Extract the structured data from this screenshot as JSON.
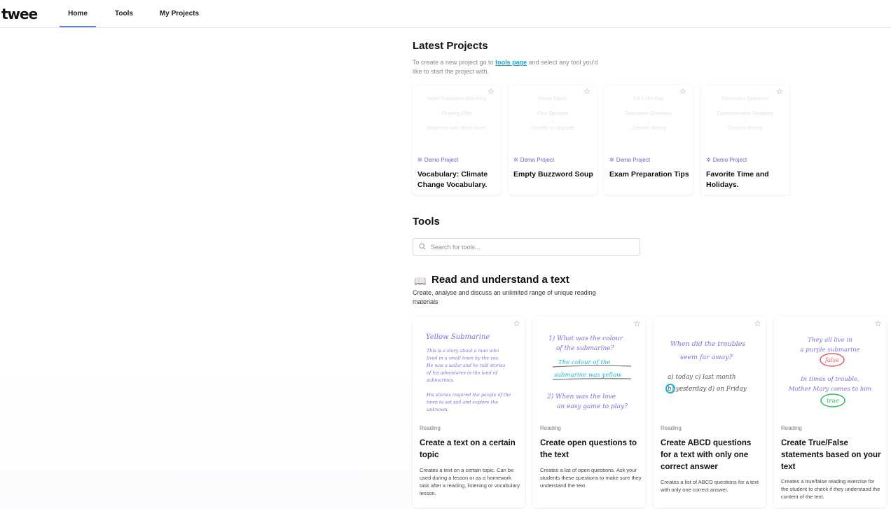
{
  "nav": {
    "logo": "twee",
    "home": "Home",
    "tools": "Tools",
    "my_projects": "My Projects"
  },
  "latest": {
    "title": "Latest Projects",
    "desc_before": "To create a new project go to ",
    "desc_link": "tools page",
    "desc_after": " and select any tool you'd like to start the project with.",
    "projects": [
      {
        "steps": [
          "Word-Translation Matching",
          "↓",
          "Reading Gifts",
          "↓",
          "Rephrase with Word Given"
        ],
        "tag": "Demo Project",
        "title": "Vocabulary: Climate Change Vocabulary."
      },
      {
        "steps": [
          "Essay Topics",
          "↓",
          "Four Opinions",
          "↓",
          "Simplify or Upgrade"
        ],
        "tag": "Demo Project",
        "title": "Empty Buzzword Soup"
      },
      {
        "steps": [
          "Fill in the Gap",
          "↓",
          "Discussion Questions",
          "↓",
          "Creative Writing"
        ],
        "tag": "Demo Project",
        "title": "Exam Preparation Tips"
      },
      {
        "steps": [
          "Discussion Questions",
          "↓",
          "Communicative Situations",
          "↓",
          "Creative Writing"
        ],
        "tag": "Demo Project",
        "title": "Favorite Time and Holidays."
      }
    ]
  },
  "tools": {
    "title": "Tools",
    "search_placeholder": "Search for tools...",
    "category": {
      "icon": "📖",
      "title": "Read and understand a text",
      "desc": "Create, analyse and discuss an unlimited range of unique reading materials"
    },
    "cards": [
      {
        "label": "Reading",
        "title": "Create a text on a certain topic",
        "desc": "Creates a text on a certain topic. Can be used during a lesson or as a homework task after a reading, listening or vocabulary lesson.",
        "art": {
          "heading": "Yellow Submarine",
          "lines": [
            "This is a story about a man who",
            "lived in a small town by the sea.",
            "He was a sailor and he told stories",
            "of his adventures in the land of",
            "submarines.",
            "",
            "His stories inspired the people of the",
            "town to set sail and explore the",
            "unknown."
          ]
        }
      },
      {
        "label": "Reading",
        "title": "Create open questions to the text",
        "desc": "Creates a list of open questions. Ask your students these questions to make sure they understand the text.",
        "art": {
          "q1a": "1) What was the colour",
          "q1b": "of the submarine?",
          "a1a": "The colour of the",
          "a1b": "submarine was yellow",
          "q2a": "2) When was the love",
          "q2b": "an easy game to play?"
        }
      },
      {
        "label": "Reading",
        "title": "Create ABCD questions for a text with only one correct answer",
        "desc": "Creates a list of ABCD questions for a text with only one correct answer.",
        "art": {
          "qa": "When did the troubles",
          "qb": "seem far away?",
          "opt1": "a) today    c) last month",
          "opt2": "b) yesterday  d) on Friday"
        }
      },
      {
        "label": "Reading",
        "title": "Create True/False statements based on your text",
        "desc": "Creates a true/false reading exercise for the student to check if they understand the content of the text.",
        "art": {
          "s1a": "They all live in",
          "s1b": "a purple submarine",
          "false": "false",
          "s2a": "In times of trouble,",
          "s2b": "Mother Mary comes to him",
          "true": "true"
        }
      }
    ]
  },
  "colors": {
    "accent": "#5b7fe6",
    "link": "#17a6c9",
    "demo_tag": "#6a5fcf",
    "hand_purple": "#7a6fe0",
    "hand_cyan": "#17b7d6",
    "hand_red": "#e85a6a",
    "hand_green": "#2fbf5a"
  }
}
